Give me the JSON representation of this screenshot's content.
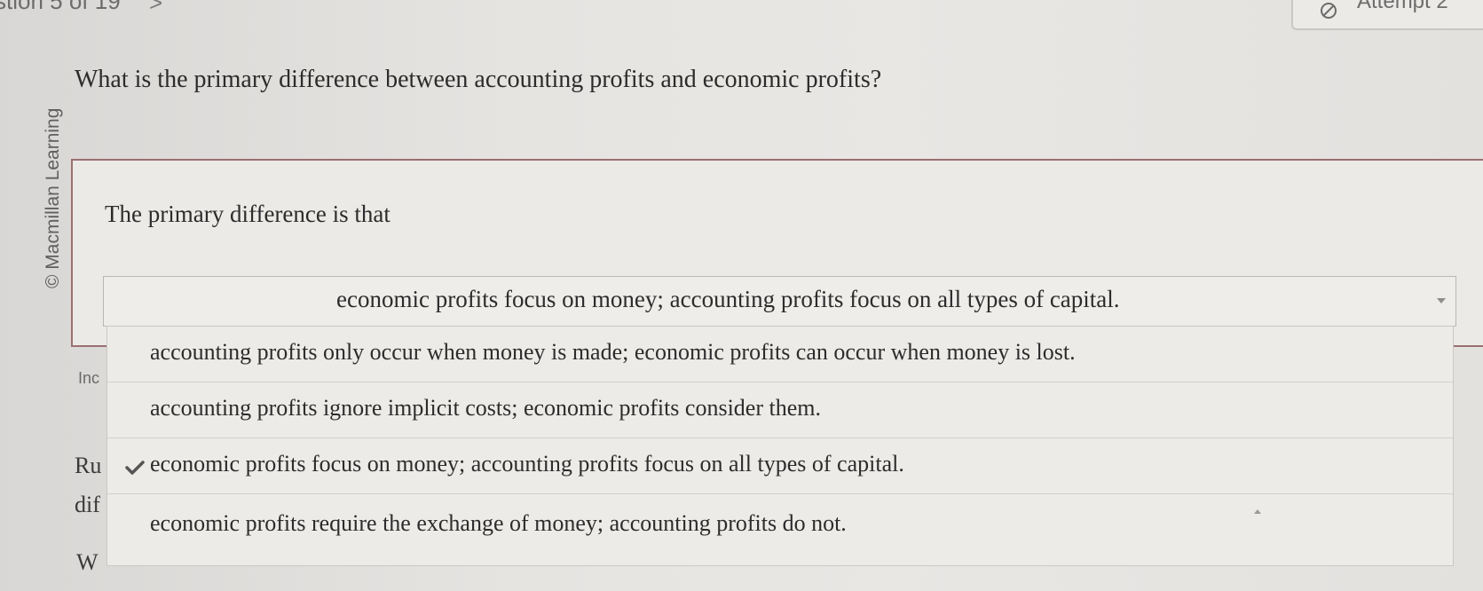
{
  "header": {
    "question_counter": "stion 5 of 19",
    "next_glyph": ">",
    "attempt_label": "Attempt 2"
  },
  "credit": "© Macmillan Learning",
  "question": {
    "text": "What is the primary difference between accounting profits and economic profits?",
    "stem": "The primary difference is that"
  },
  "background_fragments": {
    "inc": "Inc",
    "ru": "Ru",
    "dif": "dif",
    "w": "W"
  },
  "dropdown": {
    "selected": "economic profits focus on money; accounting profits focus on all types of capital.",
    "options": [
      {
        "label": "accounting profits only occur when money is made; economic profits can occur when money is lost.",
        "checked": false
      },
      {
        "label": "accounting profits ignore implicit costs; economic profits consider them.",
        "checked": false
      },
      {
        "label": "economic profits focus on money; accounting profits focus on all types of capital.",
        "checked": true
      },
      {
        "label": "economic profits require the exchange of money; accounting profits do not.",
        "checked": false
      }
    ]
  },
  "colors": {
    "answer_box_border": "#9a7070",
    "text": "#2c2c2c"
  }
}
